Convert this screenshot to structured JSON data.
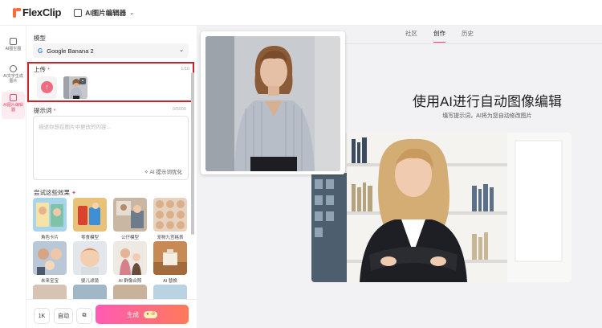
{
  "header": {
    "logo_text": "FlexClip",
    "tool_label": "AI图片编辑器"
  },
  "rail": {
    "items": [
      {
        "label": "AI图生图"
      },
      {
        "label": "AI文字生成图片"
      },
      {
        "label": "AI图片编辑器"
      }
    ]
  },
  "panel": {
    "model_label": "模型",
    "model_value": "Google Banana 2",
    "upload_label": "上传",
    "upload_counter": "1/10",
    "prompt_label": "提示词",
    "prompt_counter": "0/5000",
    "prompt_placeholder": "描述你想在图片中更改的内容...",
    "optimize_label": "AI 提示词优化",
    "effects_title": "尝试这些效果",
    "effects": [
      {
        "label": "角色卡片"
      },
      {
        "label": "零食模型"
      },
      {
        "label": "公仔模型"
      },
      {
        "label": "宠物九宫格表"
      },
      {
        "label": "未来宝宝"
      },
      {
        "label": "婴儿滤镜"
      },
      {
        "label": "AI 群像合照"
      },
      {
        "label": "AI 替换"
      }
    ],
    "resolution": "1K",
    "ratio": "自动",
    "generate_label": "生成",
    "generate_cost": "-8"
  },
  "main": {
    "tabs": [
      "社区",
      "创作",
      "历史"
    ],
    "active_tab": "创作",
    "hero_title": "使用AI进行自动图像编辑",
    "hero_subtitle": "填写提示词，AI将为您自动修改图片"
  },
  "colors": {
    "accent": "#e8456b",
    "highlight_border": "#d0202a",
    "generate_gradient_start": "#ff5ab4",
    "generate_gradient_end": "#ff7a59"
  }
}
